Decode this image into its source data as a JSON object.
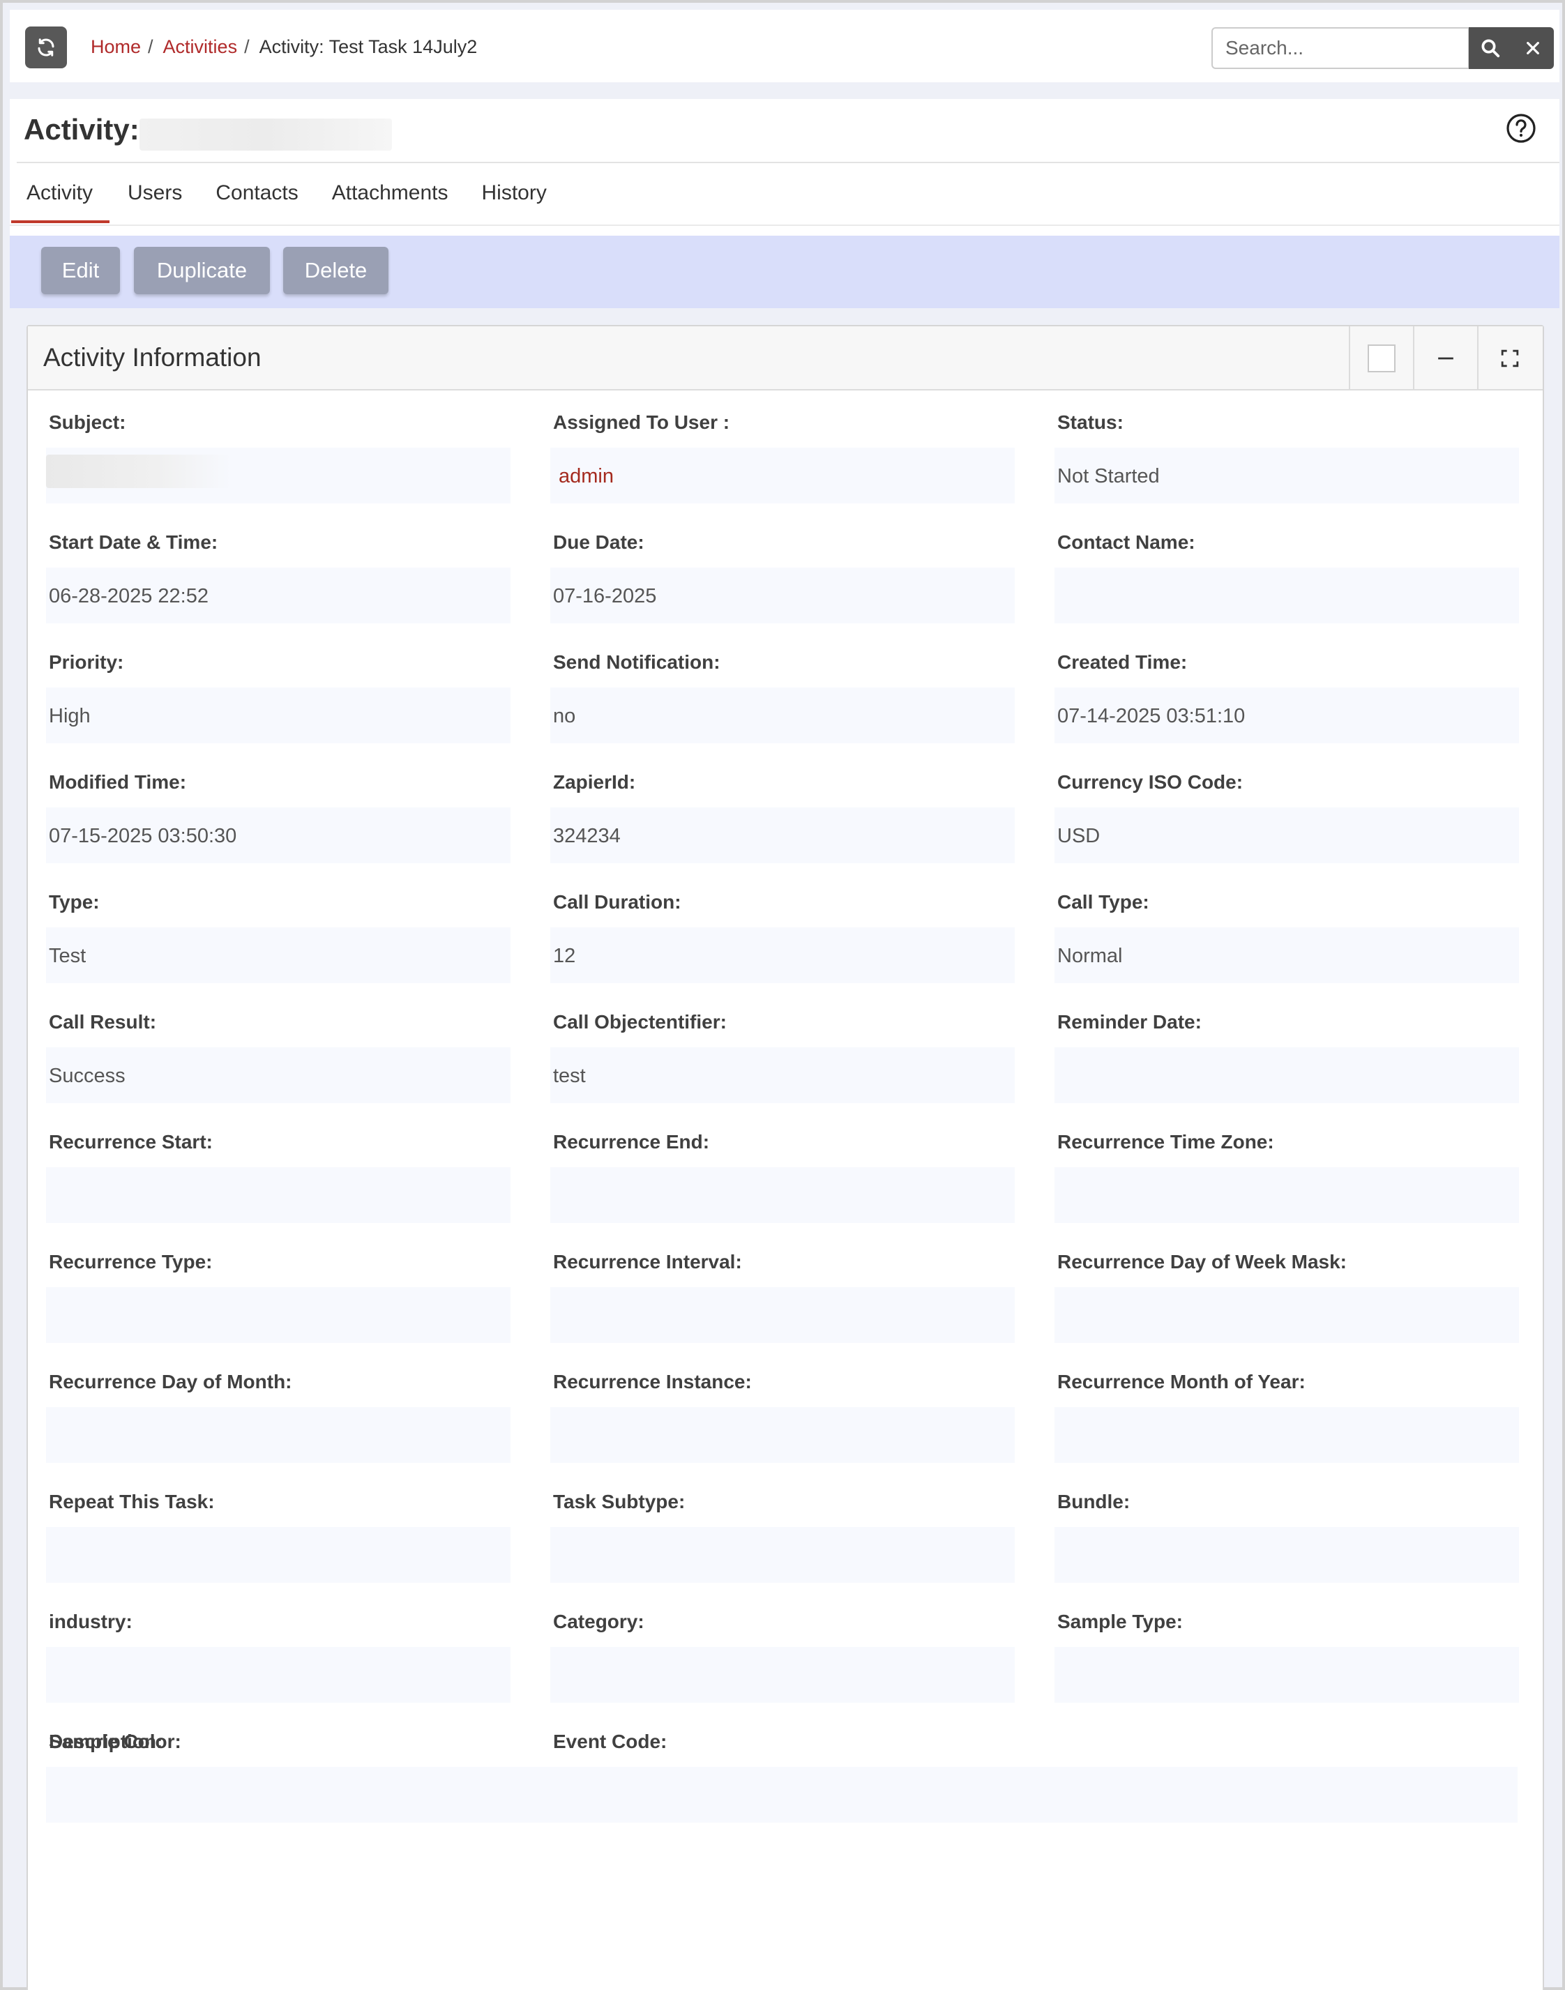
{
  "breadcrumb": {
    "home": "Home",
    "activities": "Activities",
    "current": "Activity: Test Task 14July2"
  },
  "search": {
    "placeholder": "Search..."
  },
  "header": {
    "title_prefix": "Activity:",
    "tabs": [
      "Activity",
      "Users",
      "Contacts",
      "Attachments",
      "History"
    ],
    "active_tab": "Activity"
  },
  "actions": {
    "edit": "Edit",
    "duplicate": "Duplicate",
    "delete": "Delete"
  },
  "panel": {
    "title": "Activity Information",
    "fields": [
      {
        "label": "Subject:",
        "value": ""
      },
      {
        "label": "Assigned To User :",
        "value": "admin"
      },
      {
        "label": "Status:",
        "value": "Not Started"
      },
      {
        "label": "Start Date & Time:",
        "value": "06-28-2025 22:52"
      },
      {
        "label": "Due Date:",
        "value": "07-16-2025"
      },
      {
        "label": "Contact Name:",
        "value": ""
      },
      {
        "label": "Priority:",
        "value": "High"
      },
      {
        "label": "Send Notification:",
        "value": "no"
      },
      {
        "label": "Created Time:",
        "value": "07-14-2025 03:51:10"
      },
      {
        "label": "Modified Time:",
        "value": "07-15-2025 03:50:30"
      },
      {
        "label": "ZapierId:",
        "value": "324234"
      },
      {
        "label": "Currency ISO Code:",
        "value": "USD"
      },
      {
        "label": "Type:",
        "value": "Test"
      },
      {
        "label": "Call Duration:",
        "value": "12"
      },
      {
        "label": "Call Type:",
        "value": "Normal"
      },
      {
        "label": "Call Result:",
        "value": "Success"
      },
      {
        "label": "Call Objectentifier:",
        "value": "test"
      },
      {
        "label": "Reminder Date:",
        "value": ""
      },
      {
        "label": "Recurrence Start:",
        "value": ""
      },
      {
        "label": "Recurrence End:",
        "value": ""
      },
      {
        "label": "Recurrence Time Zone:",
        "value": ""
      },
      {
        "label": "Recurrence Type:",
        "value": ""
      },
      {
        "label": "Recurrence Interval:",
        "value": ""
      },
      {
        "label": "Recurrence Day of Week Mask:",
        "value": ""
      },
      {
        "label": "Recurrence Day of Month:",
        "value": ""
      },
      {
        "label": "Recurrence Instance:",
        "value": ""
      },
      {
        "label": "Recurrence Month of Year:",
        "value": ""
      },
      {
        "label": "Repeat This Task:",
        "value": ""
      },
      {
        "label": "Task Subtype:",
        "value": ""
      },
      {
        "label": "Bundle:",
        "value": ""
      },
      {
        "label": "industry:",
        "value": ""
      },
      {
        "label": "Category:",
        "value": ""
      },
      {
        "label": "Sample Type:",
        "value": ""
      },
      {
        "label": "Sample Color:",
        "value": ""
      },
      {
        "label": "Event Code:",
        "value": ""
      },
      {
        "label": "Description:",
        "value": ""
      }
    ]
  },
  "icons": {
    "refresh": "refresh-icon",
    "search": "search-icon",
    "clear": "close-icon",
    "help": "help-icon",
    "minimize": "minimize-icon",
    "expand": "expand-icon"
  },
  "colors": {
    "link": "#b02a2a",
    "tab_active_underline": "#c0392b",
    "action_bar": "#d9defa",
    "action_button": "#9aa0b4",
    "field_background": "#f7f9fe"
  }
}
